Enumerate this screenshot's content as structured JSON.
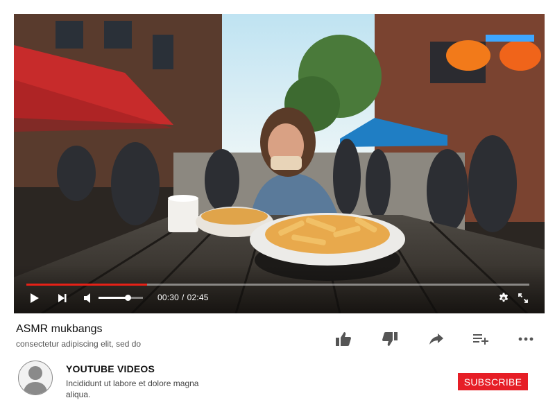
{
  "player": {
    "progress_fraction": 0.24,
    "volume_fraction": 0.65,
    "time_current": "00:30",
    "time_separator": "/",
    "time_total": "02:45",
    "controls": {
      "play": "play-icon",
      "next": "next-icon",
      "volume": "volume-icon",
      "settings": "gear-icon",
      "fullscreen": "fullscreen-icon"
    },
    "accent_color": "#e62117"
  },
  "video": {
    "title": "ASMR mukbangs",
    "subtitle": "consectetur adipiscing elit, sed do"
  },
  "actions": [
    "like-icon",
    "dislike-icon",
    "share-icon",
    "add-to-playlist-icon",
    "more-icon"
  ],
  "channel": {
    "name": "YOUTUBE VIDEOS",
    "description": "Incididunt ut labore et dolore magna aliqua.",
    "subscribe_label": "SUBSCRIBE",
    "subscribe_color": "#e61e26"
  }
}
